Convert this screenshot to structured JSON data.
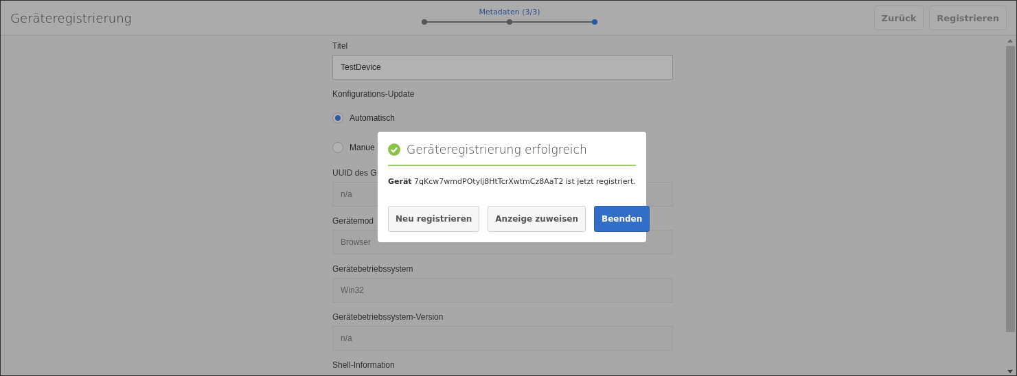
{
  "header": {
    "title": "Geräteregistrierung",
    "wizard": {
      "label": "Metadaten (3/3)",
      "steps": [
        {
          "selected": false
        },
        {
          "selected": false
        },
        {
          "selected": true
        }
      ]
    },
    "buttons": [
      {
        "label": "Zurück",
        "disabled": true
      },
      {
        "label": "Registrieren",
        "disabled": true
      }
    ]
  },
  "form": [
    {
      "kind": "field",
      "label": "Titel",
      "value": "TestDevice",
      "disabled": false
    },
    {
      "kind": "radios",
      "label": "Konfigurations-Update",
      "options": [
        {
          "label": "Automatisch",
          "selected": true
        },
        {
          "label": "Manue",
          "selected": false
        }
      ]
    },
    {
      "kind": "field",
      "label": "UUID des G",
      "value": "n/a",
      "disabled": true
    },
    {
      "kind": "field",
      "label": "Gerätemod",
      "value": "Browser",
      "disabled": true
    },
    {
      "kind": "field",
      "label": "Gerätebetriebssystem",
      "value": "Win32",
      "disabled": true
    },
    {
      "kind": "field",
      "label": "Gerätebetriebssystem-Version",
      "value": "n/a",
      "disabled": true
    },
    {
      "kind": "label",
      "label": "Shell-Information"
    }
  ],
  "dialog": {
    "title": "Geräteregistrierung erfolgreich",
    "message": "**Gerät** 7qKcw7wmdPOtylj8HtTcrXwtmCz8AaT2 ist jetzt registriert.",
    "buttons": [
      {
        "label": "Neu registrieren",
        "primary": false
      },
      {
        "label": "Anzeige zuweisen",
        "primary": false
      },
      {
        "label": "Beenden",
        "primary": true
      }
    ]
  }
}
